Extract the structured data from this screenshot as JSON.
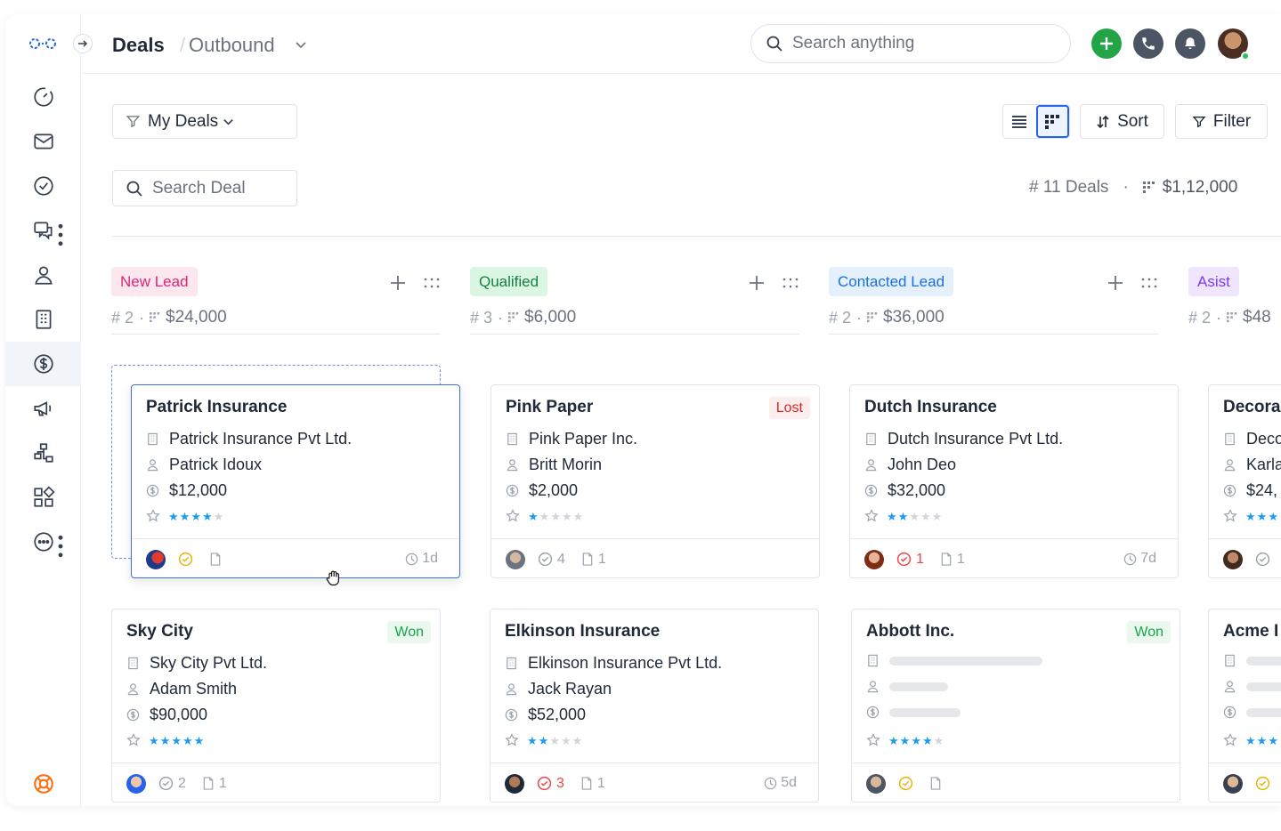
{
  "header": {
    "title": "Deals",
    "view": "Outbound",
    "search_placeholder": "Search anything"
  },
  "toolbar": {
    "filter_preset": "My Deals",
    "sort_label": "Sort",
    "filter_label": "Filter",
    "search_deal_placeholder": "Search Deal",
    "deal_count": "# 11 Deals",
    "total_amount": "$1,12,000",
    "summary_separator": "·"
  },
  "colors": {
    "accent": "#2563eb",
    "add_button": "#22a447",
    "star": "#1d9bf0",
    "lost": "#dc2626",
    "won": "#16a34a"
  },
  "sidebar": {
    "items": [
      {
        "name": "dashboard",
        "icon": "gauge-icon"
      },
      {
        "name": "mail",
        "icon": "mail-icon"
      },
      {
        "name": "tasks",
        "icon": "check-circle-icon"
      },
      {
        "name": "chats",
        "icon": "chat-icon"
      },
      {
        "name": "contacts",
        "icon": "user-icon"
      },
      {
        "name": "companies",
        "icon": "building-icon"
      },
      {
        "name": "deals",
        "icon": "dollar-icon",
        "active": true
      },
      {
        "name": "campaigns",
        "icon": "megaphone-icon"
      },
      {
        "name": "workflows",
        "icon": "flow-icon"
      },
      {
        "name": "apps",
        "icon": "apps-icon"
      },
      {
        "name": "more",
        "icon": "more-icon"
      }
    ]
  },
  "columns": [
    {
      "label": "New Lead",
      "count": "# 2",
      "amount": "$24,000"
    },
    {
      "label": "Qualified",
      "count": "# 3",
      "amount": "$6,000"
    },
    {
      "label": "Contacted Lead",
      "count": "# 2",
      "amount": "$36,000"
    },
    {
      "label": "Asist",
      "count": "# 2",
      "amount": "$48"
    }
  ],
  "cards": [
    {
      "title": "Patrick Insurance",
      "company": "Patrick Insurance Pvt Ltd.",
      "contact": "Patrick Idoux",
      "amount": "$12,000",
      "rating": 4,
      "tasks": "",
      "files": "",
      "age": "1d"
    },
    {
      "title": "Pink Paper",
      "badge": "Lost",
      "company": "Pink Paper Inc.",
      "contact": "Britt Morin",
      "amount": "$2,000",
      "rating": 1,
      "tasks": "4",
      "files": "1",
      "age": ""
    },
    {
      "title": "Dutch Insurance",
      "company": "Dutch Insurance Pvt Ltd.",
      "contact": "John Deo",
      "amount": "$32,000",
      "rating": 2,
      "tasks": "1",
      "files": "1",
      "age": "7d"
    },
    {
      "title": "Decora",
      "company": "Deco",
      "contact": "Karla",
      "amount": "$24,",
      "rating": 3
    },
    {
      "title": "Sky City",
      "badge": "Won",
      "company": "Sky City Pvt Ltd.",
      "contact": "Adam Smith",
      "amount": "$90,000",
      "rating": 5,
      "tasks": "2",
      "files": "1",
      "age": ""
    },
    {
      "title": "Elkinson Insurance",
      "company": "Elkinson Insurance Pvt Ltd.",
      "contact": "Jack Rayan",
      "amount": "$52,000",
      "rating": 2,
      "tasks": "3",
      "files": "1",
      "age": "5d"
    },
    {
      "title": "Abbott Inc.",
      "badge": "Won",
      "rating": 4
    },
    {
      "title": "Acme I",
      "rating": 3
    }
  ]
}
